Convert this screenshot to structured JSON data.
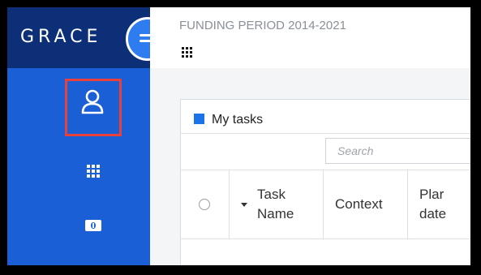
{
  "app": {
    "brand": "GRACE"
  },
  "header": {
    "period": "FUNDING PERIOD 2014-2021"
  },
  "tasks": {
    "title": "My tasks",
    "search_placeholder": "Search",
    "columns": [
      {
        "line1": "Task",
        "line2": "Name"
      },
      {
        "line1": "Context"
      },
      {
        "line1": "Plar",
        "line2": "date"
      }
    ]
  },
  "colors": {
    "sidebar": "#1a5fd6",
    "brand_bar": "#0c2f77",
    "highlight": "#e8403a",
    "accent": "#1a73e8"
  },
  "icons": [
    "menu-icon",
    "user-icon",
    "apps-grid-icon",
    "money-icon"
  ]
}
